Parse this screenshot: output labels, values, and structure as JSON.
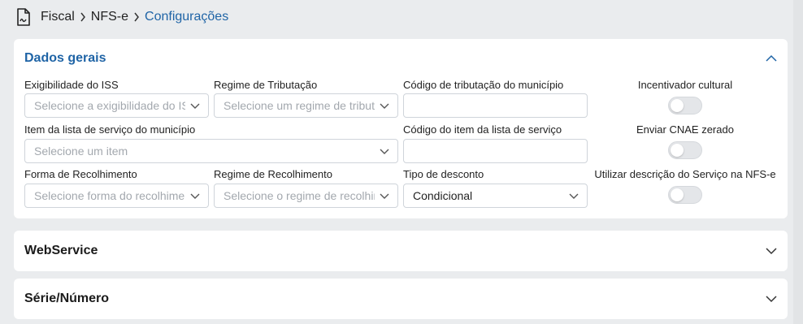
{
  "breadcrumb": {
    "items": [
      "Fiscal",
      "NFS-e",
      "Configurações"
    ]
  },
  "colors": {
    "accent": "#1f64a6",
    "page_bg": "#eaecee",
    "toggle_off": "#e4e6e9"
  },
  "general": {
    "title": "Dados gerais",
    "exigibilidade": {
      "label": "Exigibilidade do ISS",
      "placeholder": "Selecione a exigibilidade do ISS"
    },
    "regime_tributacao": {
      "label": "Regime de Tributação",
      "placeholder": "Selecione um regime de tributação"
    },
    "codigo_tributacao": {
      "label": "Código de tributação do município",
      "value": ""
    },
    "incentivador": {
      "label": "Incentivador cultural",
      "checked": false
    },
    "item_lista": {
      "label": "Item da lista de serviço do município",
      "placeholder": "Selecione um item"
    },
    "codigo_item": {
      "label": "Código do item da lista de serviço",
      "value": ""
    },
    "cnae_zerado": {
      "label": "Enviar CNAE zerado",
      "checked": false
    },
    "forma_recolhimento": {
      "label": "Forma de Recolhimento",
      "placeholder": "Selecione forma do recolhimento"
    },
    "regime_recolhimento": {
      "label": "Regime de Recolhimento",
      "placeholder": "Selecione o regime de recolhimento"
    },
    "tipo_desconto": {
      "label": "Tipo de desconto",
      "value": "Condicional"
    },
    "descricao_servico": {
      "label": "Utilizar descrição do Serviço na NFS-e",
      "checked": false
    }
  },
  "webservice": {
    "title": "WebService"
  },
  "serie": {
    "title": "Série/Número"
  }
}
